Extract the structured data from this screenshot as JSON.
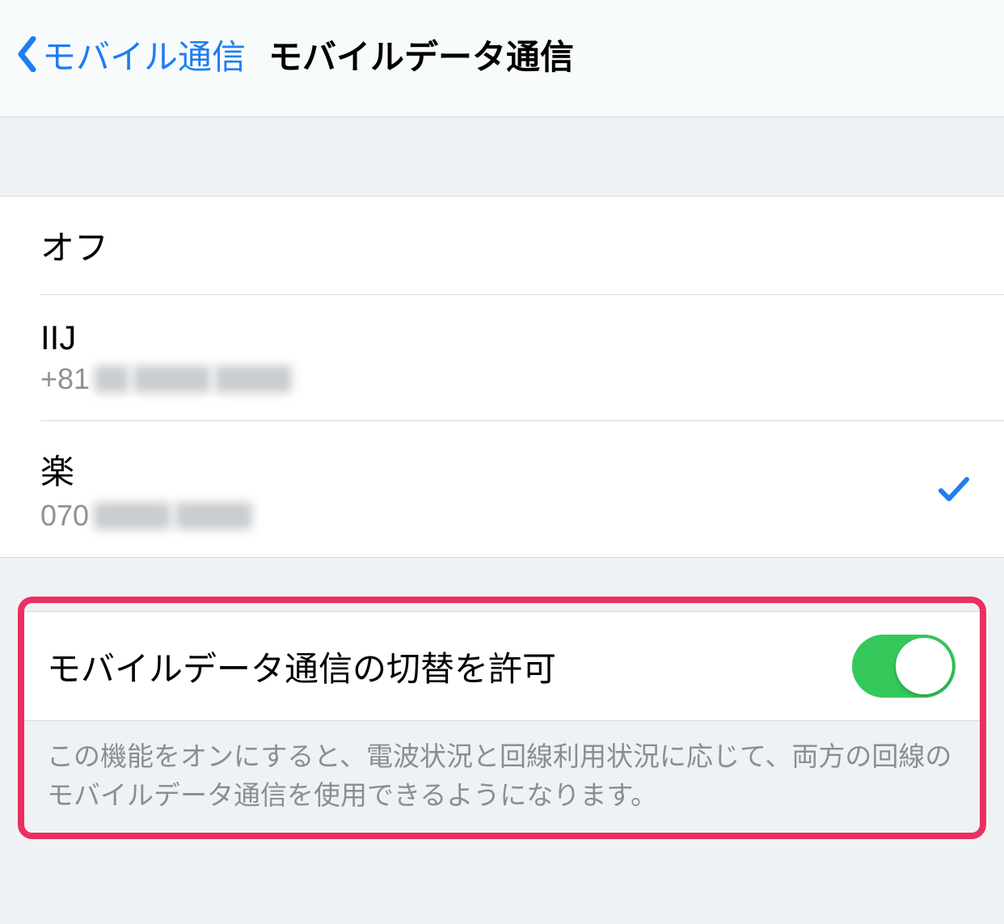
{
  "nav": {
    "back_label": "モバイル通信",
    "title": "モバイルデータ通信"
  },
  "options": [
    {
      "title": "オフ",
      "subtitle_prefix": "",
      "has_sub": false,
      "selected": false
    },
    {
      "title": "IIJ",
      "subtitle_prefix": "+81",
      "has_sub": true,
      "selected": false
    },
    {
      "title": "楽",
      "subtitle_prefix": "070",
      "has_sub": true,
      "selected": true
    }
  ],
  "switch": {
    "label": "モバイルデータ通信の切替を許可",
    "on": true,
    "description": "この機能をオンにすると、電波状況と回線利用状況に応じて、両方の回線のモバイルデータ通信を使用できるようになります。"
  },
  "colors": {
    "accent": "#1e7df0",
    "highlight": "#ec2f63",
    "switch_on": "#34c85a"
  }
}
